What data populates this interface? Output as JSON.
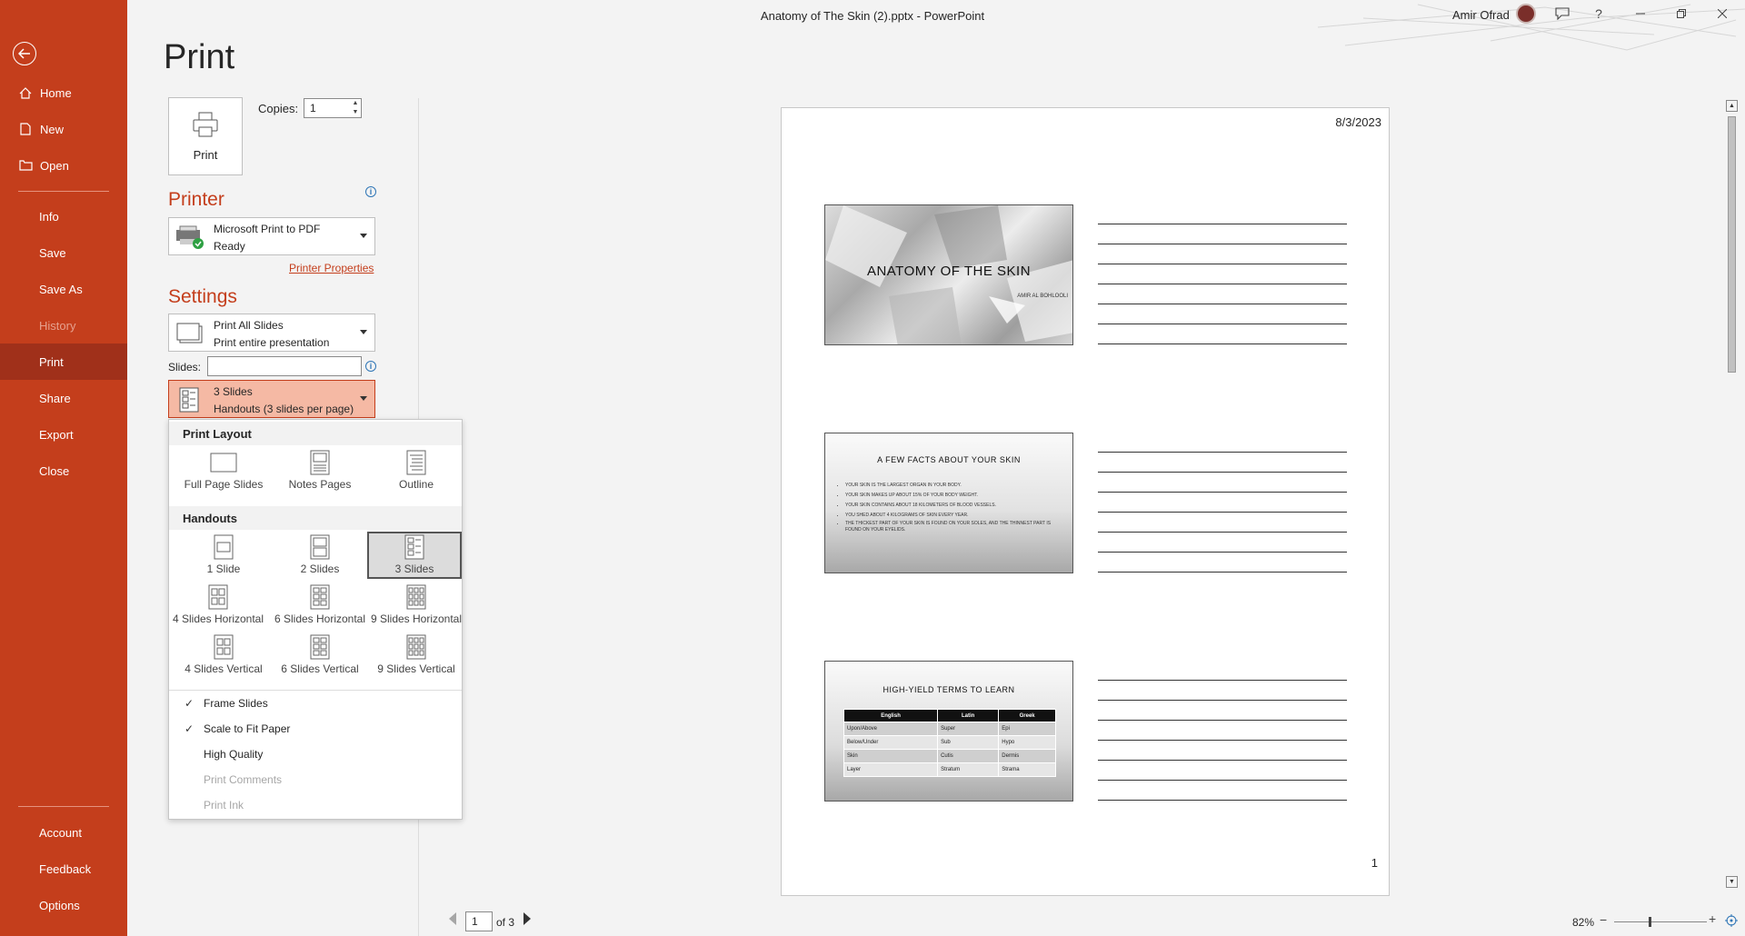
{
  "window": {
    "title": "Anatomy of The Skin (2).pptx  -  PowerPoint",
    "user_name": "Amir Ofrad"
  },
  "sidebar": {
    "items": [
      {
        "label": "Home",
        "icon": "home-icon"
      },
      {
        "label": "New",
        "icon": "new-doc-icon"
      },
      {
        "label": "Open",
        "icon": "folder-icon"
      },
      {
        "label": "Info"
      },
      {
        "label": "Save"
      },
      {
        "label": "Save As"
      },
      {
        "label": "History"
      },
      {
        "label": "Print"
      },
      {
        "label": "Share"
      },
      {
        "label": "Export"
      },
      {
        "label": "Close"
      },
      {
        "label": "Account"
      },
      {
        "label": "Feedback"
      },
      {
        "label": "Options"
      }
    ]
  },
  "print": {
    "title": "Print",
    "print_button": "Print",
    "copies_label": "Copies:",
    "copies_value": "1",
    "printer_heading": "Printer",
    "printer_name": "Microsoft Print to PDF",
    "printer_status": "Ready",
    "printer_properties": "Printer Properties",
    "settings_heading": "Settings",
    "range_line1": "Print All Slides",
    "range_line2": "Print entire presentation",
    "slides_label": "Slides:",
    "slides_value": "",
    "layout_line1": "3 Slides",
    "layout_line2": "Handouts (3 slides per page)"
  },
  "layout_popup": {
    "print_layout_heading": "Print Layout",
    "print_layout_options": [
      "Full Page Slides",
      "Notes Pages",
      "Outline"
    ],
    "handouts_heading": "Handouts",
    "handouts_options": [
      "1 Slide",
      "2 Slides",
      "3 Slides",
      "4 Slides Horizontal",
      "6 Slides Horizontal",
      "9 Slides Horizontal",
      "4 Slides Vertical",
      "6 Slides Vertical",
      "9 Slides Vertical"
    ],
    "selected_option": "3 Slides",
    "toggles": [
      {
        "label": "Frame Slides",
        "checked": true,
        "enabled": true
      },
      {
        "label": "Scale to Fit Paper",
        "checked": true,
        "enabled": true
      },
      {
        "label": "High Quality",
        "checked": false,
        "enabled": true
      },
      {
        "label": "Print Comments",
        "checked": false,
        "enabled": false
      },
      {
        "label": "Print Ink",
        "checked": false,
        "enabled": false
      }
    ]
  },
  "preview": {
    "date": "8/3/2023",
    "page_number": "1",
    "slide1": {
      "title": "ANATOMY OF THE SKIN",
      "subtitle": "AMIR AL BOHLOOLI"
    },
    "slide2": {
      "title": "A FEW FACTS ABOUT YOUR SKIN",
      "bullets": [
        "YOUR SKIN IS THE LARGEST ORGAN IN YOUR BODY.",
        "YOUR SKIN MAKES UP ABOUT 15% OF YOUR BODY WEIGHT.",
        "YOUR SKIN CONTAINS ABOUT 18 KILOMETERS OF BLOOD VESSELS.",
        "YOU SHED ABOUT 4 KILOGRAMS OF SKIN EVERY YEAR.",
        "THE THICKEST PART OF YOUR SKIN IS FOUND ON YOUR SOLES, AND THE THINNEST PART IS FOUND ON YOUR EYELIDS."
      ]
    },
    "slide3": {
      "title": "HIGH-YIELD TERMS TO LEARN",
      "headers": [
        "English",
        "Latin",
        "Greek"
      ],
      "rows": [
        [
          "Upon/Above",
          "Super",
          "Epi"
        ],
        [
          "Below/Under",
          "Sub",
          "Hypo"
        ],
        [
          "Skin",
          "Cutis",
          "Dermis"
        ],
        [
          "Layer",
          "Stratum",
          "Strama"
        ]
      ]
    }
  },
  "page_nav": {
    "current": "1",
    "of_text": "of 3"
  },
  "zoom": {
    "percent": "82%"
  },
  "colors": {
    "accent": "#c43e1c",
    "accent_dark": "#a0301a",
    "selected_dd": "#f5b9a4"
  }
}
